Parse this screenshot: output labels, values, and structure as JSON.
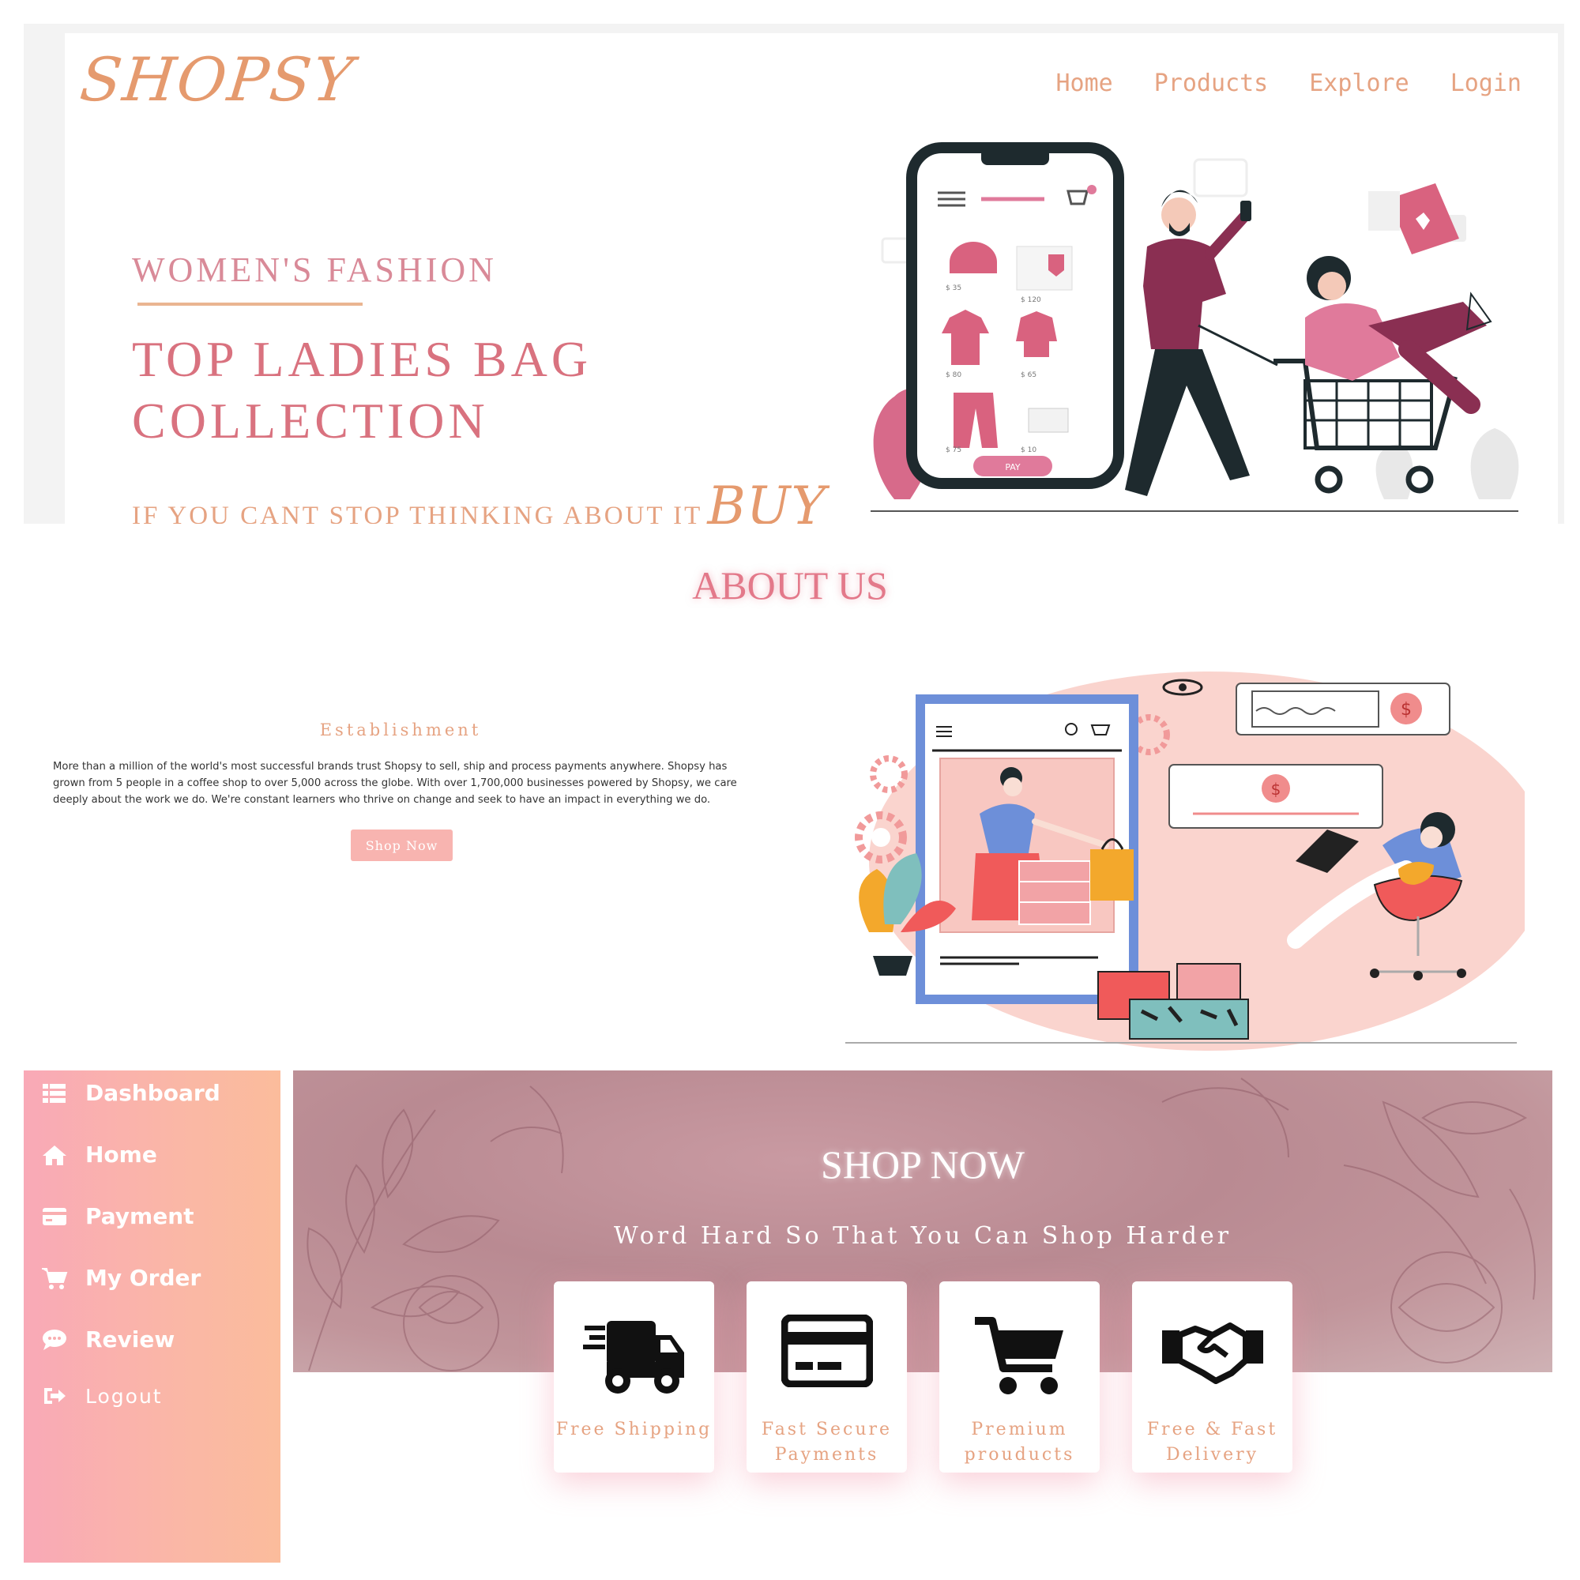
{
  "header": {
    "logo": "SHOPSY",
    "nav": [
      "Home",
      "Products",
      "Explore",
      "Login"
    ]
  },
  "hero": {
    "subtitle": "WOMEN'S FASHION",
    "title_line1": "TOP LADIES BAG",
    "title_line2": "COLLECTION",
    "tagline": "IF YOU CANT STOP THINKING ABOUT IT",
    "tagline_emphasis": "BUY",
    "illustration": {
      "prices": [
        "$ 35",
        "$ 120",
        "$ 80",
        "$ 65",
        "$ 75",
        "$ 10"
      ],
      "pay_label": "PAY"
    }
  },
  "about": {
    "title": "ABOUT US",
    "heading": "Establishment",
    "text": "More than a million of the world's most successful brands trust Shopsy to sell, ship and process payments anywhere. Shopsy has grown from 5 people in a coffee shop to over 5,000 across the globe. With over 1,700,000 businesses powered by Shopsy, we care deeply about the work we do. We're constant learners who thrive on change and seek to have an impact in everything we do.",
    "button": "Shop Now"
  },
  "sidebar": {
    "items": [
      {
        "label": "Dashboard",
        "icon": "list-icon"
      },
      {
        "label": "Home",
        "icon": "home-icon"
      },
      {
        "label": "Payment",
        "icon": "credit-card-icon"
      },
      {
        "label": "My Order",
        "icon": "cart-icon"
      },
      {
        "label": "Review",
        "icon": "comment-icon"
      },
      {
        "label": "Logout",
        "icon": "sign-out-icon"
      }
    ]
  },
  "shop": {
    "title": "SHOP NOW",
    "subtitle": "Word Hard So That You Can Shop Harder",
    "features": [
      {
        "line1": "Free Shipping",
        "line2": "",
        "icon": "truck-icon"
      },
      {
        "line1": "Fast Secure",
        "line2": "Payments",
        "icon": "credit-card-icon"
      },
      {
        "line1": "Premium",
        "line2": "prouducts",
        "icon": "cart-icon"
      },
      {
        "line1": "Free & Fast",
        "line2": "Delivery",
        "icon": "handshake-icon"
      }
    ]
  },
  "colors": {
    "brand_peach": "#e59a6e",
    "brand_pink": "#d9727f",
    "sidebar_gradient_start": "#f9a9b7",
    "sidebar_gradient_end": "#fbbc9c",
    "button_pink": "#f8b4b0"
  }
}
